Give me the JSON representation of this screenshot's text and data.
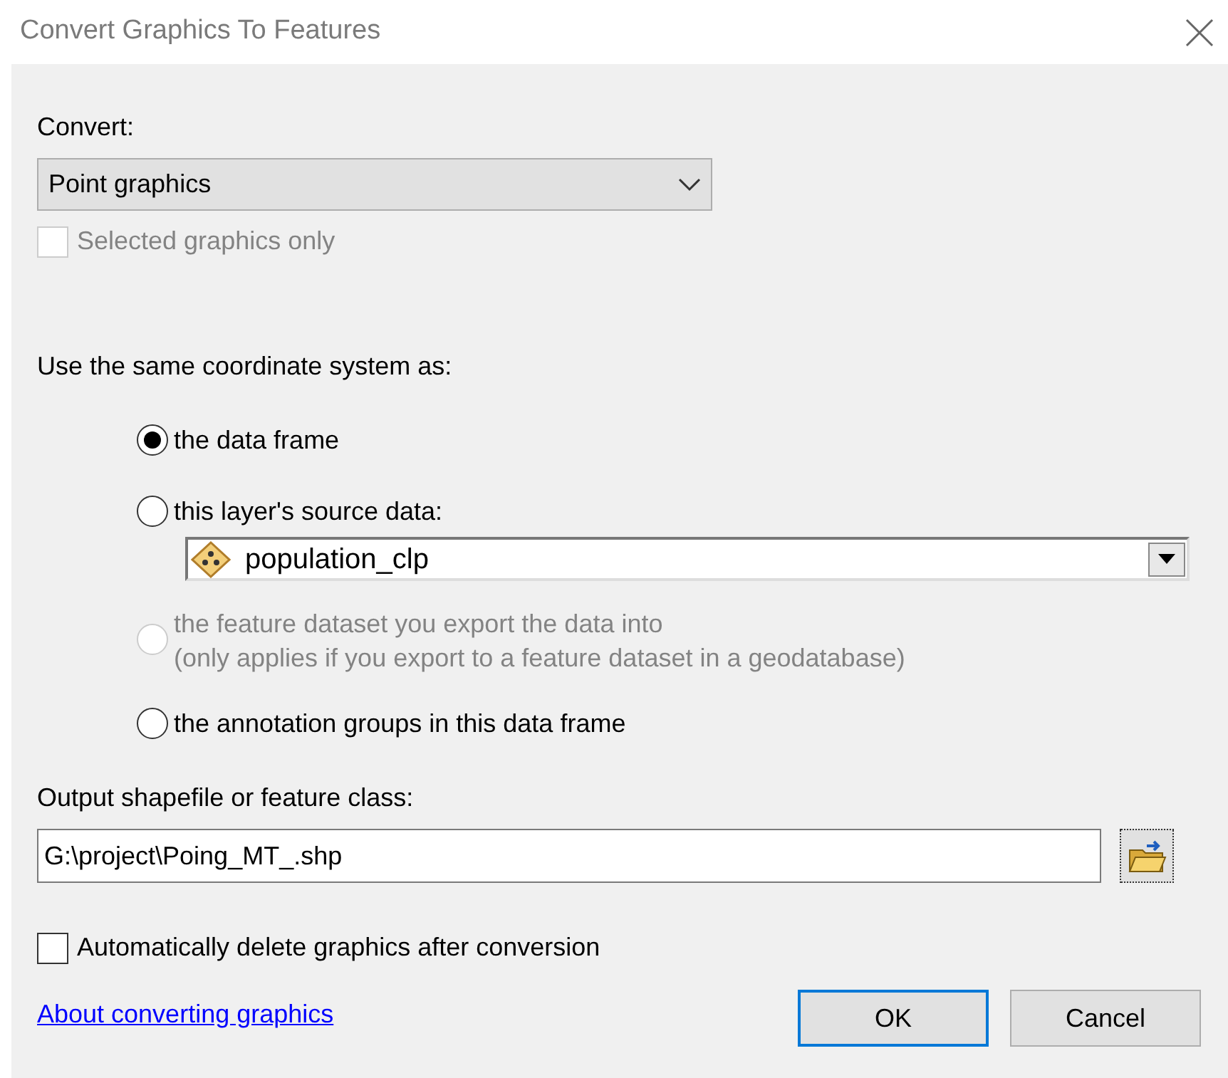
{
  "window": {
    "title": "Convert Graphics To Features"
  },
  "convert": {
    "label": "Convert:",
    "value": "Point graphics"
  },
  "selected_only": {
    "label": "Selected graphics only",
    "checked": false,
    "disabled": true
  },
  "coordinate_system": {
    "label": "Use the same coordinate system as:",
    "options": [
      {
        "label": "the data frame",
        "selected": true,
        "disabled": false
      },
      {
        "label": "this layer's source data:",
        "selected": false,
        "disabled": false
      },
      {
        "label": "the feature dataset you export the data into\n(only applies if you export to a feature dataset in a geodatabase)",
        "selected": false,
        "disabled": true
      },
      {
        "label": "the annotation groups in this data frame",
        "selected": false,
        "disabled": false
      }
    ],
    "layer": {
      "value": "population_clp"
    }
  },
  "output": {
    "label": "Output shapefile or feature class:",
    "value": "G:\\project\\Poing_MT_.shp"
  },
  "auto_delete": {
    "label": "Automatically delete graphics after conversion",
    "checked": false,
    "disabled": false
  },
  "link": "About converting graphics",
  "buttons": [
    {
      "label": "OK",
      "default": true
    },
    {
      "label": "Cancel",
      "default": false
    }
  ]
}
